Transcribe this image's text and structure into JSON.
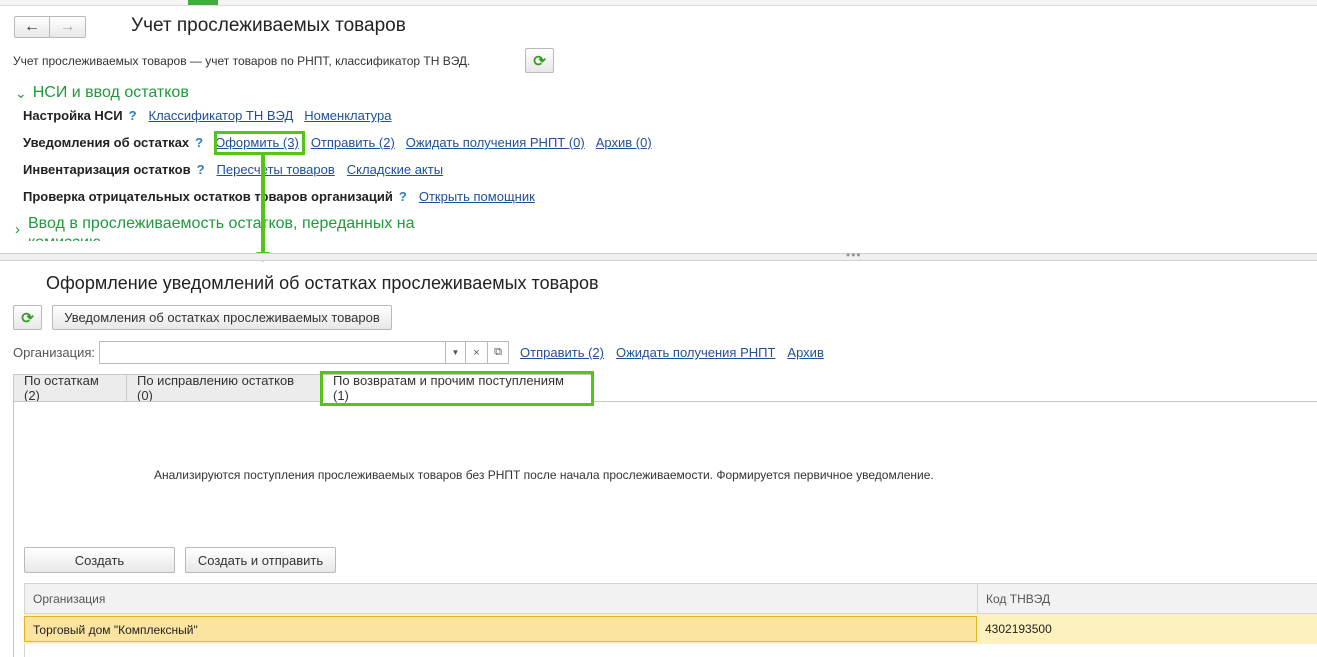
{
  "top": {
    "title": "Учет прослеживаемых товаров",
    "subtitle": "Учет прослеживаемых товаров — учет товаров по РНПТ, классификатор ТН ВЭД.",
    "group1_title": "НСИ и ввод остатков",
    "group2_title": "Ввод в прослеживаемость остатков, переданных на",
    "group2_title_cont": "комиссию",
    "rows": {
      "nsi": {
        "label": "Настройка НСИ",
        "q": "?",
        "links": [
          "Классификатор ТН ВЭД",
          "Номенклатура"
        ]
      },
      "notices": {
        "label": "Уведомления об остатках",
        "q": "?",
        "links": [
          "Оформить (3)",
          "Отправить (2)",
          "Ожидать получения РНПТ (0)",
          "Архив (0)"
        ]
      },
      "inventory": {
        "label": "Инвентаризация остатков",
        "q": "?",
        "links": [
          "Пересчеты товаров",
          "Складские акты"
        ]
      },
      "check": {
        "label": "Проверка отрицательных остатков товаров организаций",
        "q": "?",
        "links": [
          "Открыть помощник"
        ]
      }
    }
  },
  "bottom": {
    "title": "Оформление уведомлений об остатках прослеживаемых товаров",
    "report_button": "Уведомления об остатках прослеживаемых товаров",
    "org_label": "Организация:",
    "org_value": "",
    "links": [
      "Отправить (2)",
      "Ожидать получения РНПТ",
      "Архив"
    ],
    "tabs": [
      "По остаткам (2)",
      "По исправлению остатков (0)",
      "По возвратам и прочим поступлениям (1)"
    ],
    "info_text": "Анализируются поступления прослеживаемых товаров без РНПТ после начала прослеживаемости. Формируется первичное уведомление.",
    "create_button": "Создать",
    "create_send_button": "Создать и отправить",
    "table": {
      "columns": [
        "Организация",
        "Код ТНВЭД"
      ],
      "rows": [
        [
          "Торговый дом \"Комплексный\"",
          "4302193500"
        ]
      ]
    }
  },
  "colors": {
    "accent_green": "#52c41a",
    "link": "#1f4f96",
    "group_green": "#1e9b3a",
    "selected_row": "#fdf1bd"
  }
}
